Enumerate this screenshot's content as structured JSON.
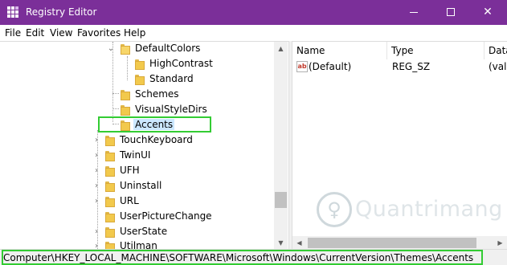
{
  "window": {
    "title": "Registry Editor",
    "minimize_glyph": "",
    "maximize_glyph": "",
    "close_glyph": "✕"
  },
  "menu": [
    "File",
    "Edit",
    "View",
    "Favorites",
    "Help"
  ],
  "tree": {
    "items": [
      {
        "label": "DefaultColors",
        "expander": "⌄",
        "icon": "folder-open-icon"
      },
      {
        "label": "HighContrast",
        "expander": "",
        "icon": "folder-icon"
      },
      {
        "label": "Standard",
        "expander": "",
        "icon": "folder-icon"
      },
      {
        "label": "Schemes",
        "expander": "",
        "icon": "folder-icon"
      },
      {
        "label": "VisualStyleDirs",
        "expander": "",
        "icon": "folder-icon"
      },
      {
        "label": "Accents",
        "expander": "",
        "icon": "folder-icon",
        "selected": true
      },
      {
        "label": "TouchKeyboard",
        "expander": "›",
        "icon": "folder-icon"
      },
      {
        "label": "TwinUI",
        "expander": "›",
        "icon": "folder-icon"
      },
      {
        "label": "UFH",
        "expander": "›",
        "icon": "folder-icon"
      },
      {
        "label": "Uninstall",
        "expander": "›",
        "icon": "folder-icon"
      },
      {
        "label": "URL",
        "expander": "›",
        "icon": "folder-icon"
      },
      {
        "label": "UserPictureChange",
        "expander": "",
        "icon": "folder-icon"
      },
      {
        "label": "UserState",
        "expander": "›",
        "icon": "folder-icon"
      },
      {
        "label": "Utilman",
        "expander": "›",
        "icon": "folder-icon"
      }
    ],
    "scroll_up": "▲",
    "scroll_down": "▼"
  },
  "values": {
    "columns": [
      "Name",
      "Type",
      "Data"
    ],
    "rows": [
      {
        "icon": "ab",
        "name": "(Default)",
        "type": "REG_SZ",
        "data": "(valu"
      }
    ],
    "scroll_left": "◀",
    "scroll_right": "▶"
  },
  "watermark": {
    "glyph": "♀",
    "text": "Quantrimang"
  },
  "status": {
    "path": "Computer\\HKEY_LOCAL_MACHINE\\SOFTWARE\\Microsoft\\Windows\\CurrentVersion\\Themes\\Accents"
  }
}
